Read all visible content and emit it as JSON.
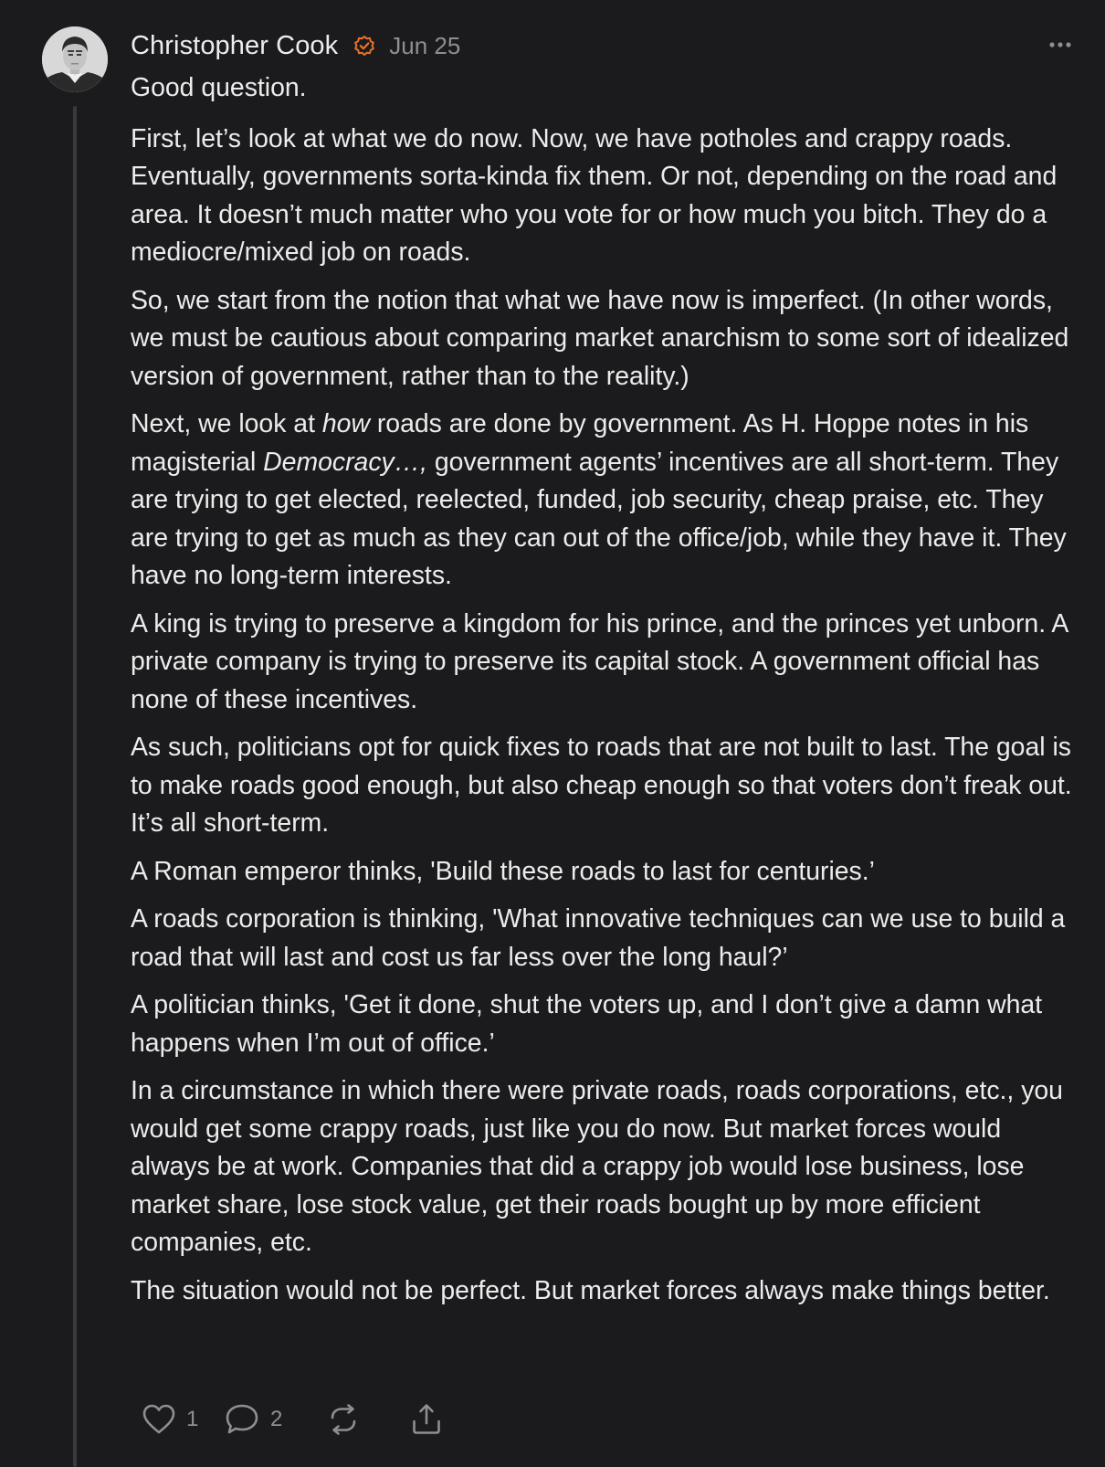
{
  "comment": {
    "author": "Christopher Cook",
    "date": "Jun 25",
    "verified_icon": "verified-badge-icon",
    "more_icon": "more-options-icon",
    "accent_color": "#e8732a",
    "paragraphs": {
      "p0": "Good question.",
      "p1": "First, let’s look at what we do now. Now, we have potholes and crappy roads. Eventually, governments sorta-kinda fix them. Or not, depending on the road and area. It doesn’t much matter who you vote for or how much you bitch. They do a mediocre/mixed job on roads.",
      "p2": "So, we start from the notion that what we have now is imperfect. (In other words, we must be cautious about comparing market anarchism to some sort of idealized version of government, rather than to the reality.)",
      "p3a": "Next, we look at ",
      "p3_em1": "how",
      "p3b": " roads are done by government. As H. Hoppe notes in his magisterial ",
      "p3_em2": "Democracy…,",
      "p3c": " government agents’ incentives are all short-term. They are trying to get elected, reelected, funded, job security, cheap praise, etc. They are trying to get as much as they can out of the office/job, while they have it. They have no long-term interests.",
      "p4": "A king is trying to preserve a kingdom for his prince, and the princes yet unborn. A private company is trying to preserve its capital stock. A government official has none of these incentives.",
      "p5": "As such, politicians opt for quick fixes to roads that are not built to last. The goal is to make roads good enough, but also cheap enough so that voters don’t freak out. It’s all short-term.",
      "p6": "A Roman emperor thinks, 'Build these roads to last for centuries.’",
      "p7": "A roads corporation is thinking, 'What innovative techniques can we use to build a road that will last and cost us far less over the long haul?’",
      "p8": "A politician thinks, 'Get it done, shut the voters up, and I don’t give a damn what happens when I’m out of office.’",
      "p9": "In a circumstance in which there were private roads, roads corporations, etc., you would get some crappy roads, just like you do now. But market forces would always be at work. Companies that did a crappy job would lose business, lose market share, lose stock value, get their roads bought up by more efficient companies, etc.",
      "p10": "The situation would not be perfect. But market forces always make things better."
    },
    "actions": {
      "like_count": "1",
      "reply_count": "2",
      "like_icon": "heart-icon",
      "reply_icon": "speech-bubble-icon",
      "restack_icon": "restack-icon",
      "share_icon": "share-icon"
    }
  }
}
